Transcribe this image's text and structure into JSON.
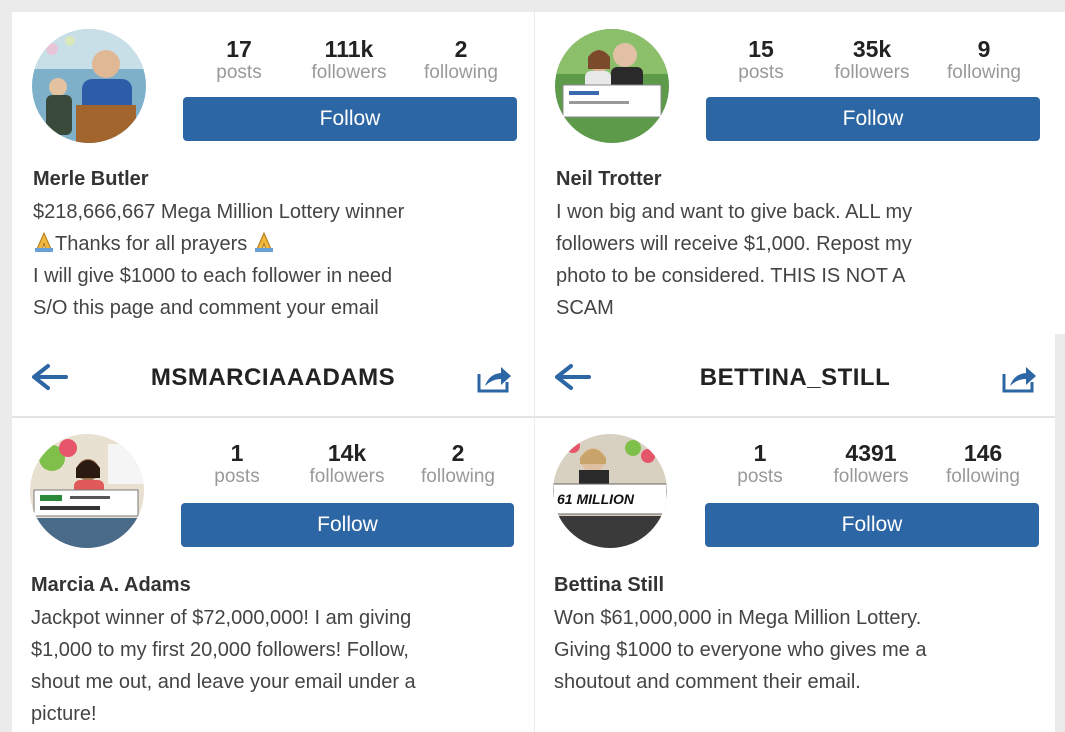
{
  "profiles": [
    {
      "name": "Merle Butler",
      "posts": "17",
      "posts_label": "posts",
      "followers": "111k",
      "followers_label": "followers",
      "following": "2",
      "following_label": "following",
      "follow_label": "Follow",
      "bio": [
        "$218,666,667 Mega Million Lottery winner",
        "Thanks for all prayers",
        "I will give $1000 to each follower in need",
        "S/O this page and comment your email"
      ],
      "avatar": "man-at-podium-photo"
    },
    {
      "name": "Neil Trotter",
      "posts": "15",
      "posts_label": "posts",
      "followers": "35k",
      "followers_label": "followers",
      "following": "9",
      "following_label": "following",
      "follow_label": "Follow",
      "bio": [
        "I won big and want to give back. ALL my",
        "followers will receive $1,000. Repost my",
        "photo to be considered. THIS IS NOT A",
        "SCAM"
      ],
      "avatar": "couple-with-big-check-photo"
    },
    {
      "username": "MSMARCIAAADAMS",
      "name": "Marcia A. Adams",
      "posts": "1",
      "posts_label": "posts",
      "followers": "14k",
      "followers_label": "followers",
      "following": "2",
      "following_label": "following",
      "follow_label": "Follow",
      "bio": [
        "Jackpot winner of $72,000,000! I am giving",
        "$1,000 to my first 20,000 followers! Follow,",
        "shout me out, and leave your email under a",
        "picture!"
      ],
      "avatar": "woman-with-big-check-photo"
    },
    {
      "username": "BETTINA_STILL",
      "name": "Bettina Still",
      "posts": "1",
      "posts_label": "posts",
      "followers": "4391",
      "followers_label": "followers",
      "following": "146",
      "following_label": "following",
      "follow_label": "Follow",
      "bio": [
        "Won $61,000,000 in Mega Million Lottery.",
        "Giving $1000 to everyone who gives me a",
        "shoutout and comment their email."
      ],
      "check_text": "61 MILLION",
      "avatar": "woman-with-61-million-check-photo"
    }
  ],
  "icons": {
    "back": "back-arrow-icon",
    "share": "share-icon",
    "pray": "praying-hands-emoji"
  },
  "colors": {
    "accent": "#2d66a4",
    "background": "#ffffff",
    "label_gray": "#999999"
  }
}
